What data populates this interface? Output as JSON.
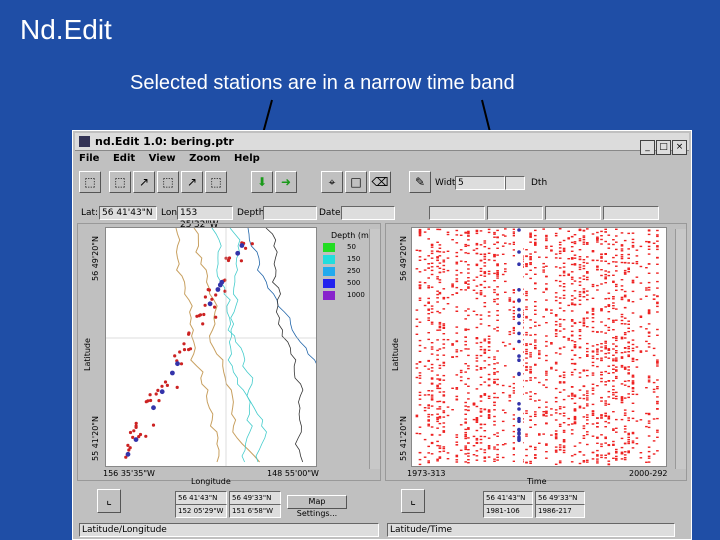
{
  "slide": {
    "title": "Nd.Edit",
    "subtitle": "Selected stations are in a narrow time band"
  },
  "window": {
    "title": "nd.Edit 1.0: bering.ptr",
    "controls": [
      "_",
      "□",
      "×"
    ],
    "menu": [
      "File",
      "Edit",
      "View",
      "Zoom",
      "Help"
    ],
    "width_label": "Width:",
    "width_value": "5",
    "depth_unit": "Dth"
  },
  "status": {
    "lat_label": "Lat:",
    "lat_value": "56 41'43\"N",
    "lon_label": "Lon:",
    "lon_value": "153 25'32\"W",
    "depth_label": "Depth:",
    "date_label": "Date:"
  },
  "map_panel": {
    "y_top": "56 49'20\"N",
    "y_bottom": "55 41'20\"N",
    "y_label": "Latitude",
    "x_left": "156 35'35\"W",
    "x_right": "148 55'00\"W",
    "x_label": "Longitude",
    "legend_title": "Depth (m)",
    "legend_values": [
      "50",
      "150",
      "250",
      "500",
      "1000"
    ],
    "legend_colors": [
      "#22dd22",
      "#22dddd",
      "#22aaee",
      "#2222ee",
      "#8822cc"
    ]
  },
  "time_panel": {
    "y_top": "56 49'20\"N",
    "y_bottom": "55 41'20\"N",
    "y_label": "Latitude",
    "x_left": "1973-313",
    "x_right": "2000-292",
    "x_label": "Time"
  },
  "bottom_left": {
    "coords": [
      "56 41'43\"N",
      "56 49'33\"N",
      "152 05'29\"W",
      "151 6'58\"W"
    ],
    "button": "Map Settings...",
    "tab": "Latitude/Longitude"
  },
  "bottom_right": {
    "coords": [
      "56 41'43\"N",
      "56 49'33\"N",
      "1981-106",
      "1986-217"
    ],
    "tab": "Latitude/Time"
  }
}
